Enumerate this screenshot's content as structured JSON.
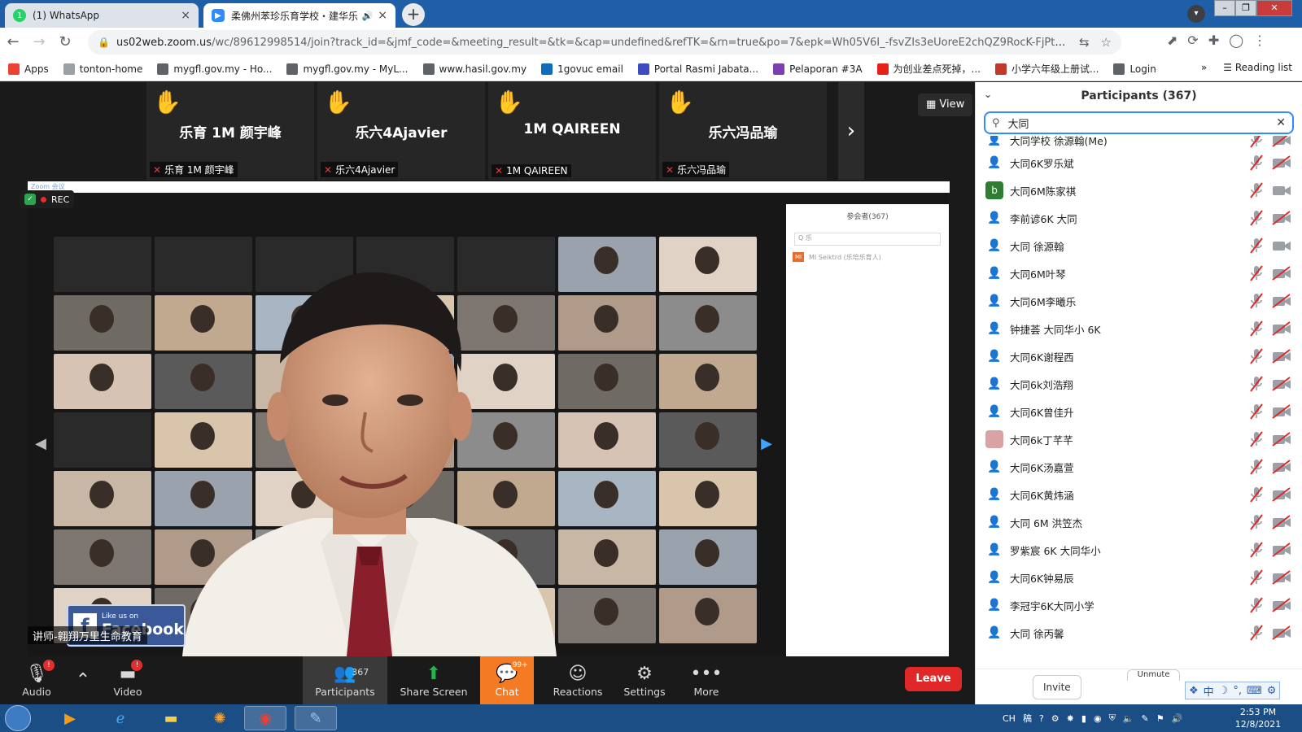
{
  "browser": {
    "tabs": [
      {
        "title": "(1) WhatsApp",
        "favicon": "whatsapp-icon",
        "active": false
      },
      {
        "title": "柔佛州苯珍乐育学校・建华乐",
        "favicon": "zoom-icon",
        "active": true
      }
    ],
    "new_tab_glyph": "+",
    "close_glyph": "×",
    "url_host": "us02web.zoom.us",
    "url_path": "/wc/89612998514/join?track_id=&jmf_code=&meeting_result=&tk=&cap=undefined&refTK=&rn=true&po=7&epk=Wh05V6I_-fsvZIs3eUoreE2chQZ9RocK-FjPtyRHkd3tfElywiU...",
    "bookmarks": [
      {
        "label": "Apps",
        "icon": "apps-grid-icon",
        "color": "#ea4335"
      },
      {
        "label": "tonton-home",
        "icon": "tonton-icon",
        "color": "#9aa0a6"
      },
      {
        "label": "mygfl.gov.my - Ho...",
        "icon": "globe-icon",
        "color": "#5f6368"
      },
      {
        "label": "mygfl.gov.my - MyL...",
        "icon": "globe-icon",
        "color": "#5f6368"
      },
      {
        "label": "www.hasil.gov.my",
        "icon": "globe-icon",
        "color": "#5f6368"
      },
      {
        "label": "1govuc email",
        "icon": "outlook-icon",
        "color": "#0f6cbd"
      },
      {
        "label": "Portal Rasmi Jabata...",
        "icon": "portal-icon",
        "color": "#3b4cc0"
      },
      {
        "label": "Pelaporan #3A",
        "icon": "forms-icon",
        "color": "#7b3fb0"
      },
      {
        "label": "为创业差点死掉，...",
        "icon": "youtube-icon",
        "color": "#e62117"
      },
      {
        "label": "小学六年级上册试...",
        "icon": "ke-icon",
        "color": "#c0392b"
      },
      {
        "label": "Login",
        "icon": "globe-icon",
        "color": "#5f6368"
      }
    ],
    "bookmarks_overflow": "»",
    "reading_list": "Reading list"
  },
  "zoom": {
    "view_label": "View",
    "strip_tiles": [
      {
        "name": "乐育 1M 颜宇峰",
        "label": "乐育 1M 颜宇峰"
      },
      {
        "name": "乐六4Ajavier",
        "label": "乐六4Ajavier"
      },
      {
        "name": "1M QAIREEN",
        "label": "1M QAIREEN"
      },
      {
        "name": "乐六冯品瑜",
        "label": "乐六冯品瑜"
      }
    ],
    "strip_next": "›",
    "rec_label": "REC",
    "speaker_name": "讲师-翱翔万里生命教育",
    "facebook": {
      "like": "Like us on",
      "name": "Facebook"
    },
    "controls": {
      "audio": "Audio",
      "video": "Video",
      "participants": "Participants",
      "participants_count": "367",
      "share": "Share Screen",
      "chat": "Chat",
      "chat_badge": "99+",
      "reactions": "Reactions",
      "settings": "Settings",
      "more": "More",
      "leave": "Leave"
    }
  },
  "participants": {
    "title": "Participants (367)",
    "search_value": "大同",
    "list": [
      {
        "name": "大同学校 徐源翰(Me)",
        "avatar": "default",
        "cam_on": false
      },
      {
        "name": "大同6K罗乐斌",
        "avatar": "default",
        "cam_on": false
      },
      {
        "name": "大同6M陈家祺",
        "avatar": "b",
        "avatar_color": "#2e7d32",
        "cam_on": true
      },
      {
        "name": "李前谚6K 大同",
        "avatar": "default",
        "cam_on": false
      },
      {
        "name": "大同 徐源翰",
        "avatar": "default",
        "cam_on": true
      },
      {
        "name": "大同6M叶琴",
        "avatar": "default",
        "cam_on": false
      },
      {
        "name": "大同6M李曦乐",
        "avatar": "default",
        "cam_on": false
      },
      {
        "name": "钟捷荟 大同华小 6K",
        "avatar": "default",
        "cam_on": false
      },
      {
        "name": "大同6K谢程西",
        "avatar": "default",
        "cam_on": false
      },
      {
        "name": "大同6k刘浩翔",
        "avatar": "default",
        "cam_on": false
      },
      {
        "name": "大同6K曾佳升",
        "avatar": "default",
        "cam_on": false
      },
      {
        "name": "大同6k丁芊芊",
        "avatar": "photo",
        "avatar_color": "#d9a3a3",
        "cam_on": false
      },
      {
        "name": "大同6K汤嘉萱",
        "avatar": "default",
        "cam_on": false
      },
      {
        "name": "大同6K黄炜涵",
        "avatar": "default",
        "cam_on": false
      },
      {
        "name": "大同 6M 洪笠杰",
        "avatar": "default",
        "cam_on": false
      },
      {
        "name": "罗紫宸 6K 大同华小",
        "avatar": "default",
        "cam_on": false
      },
      {
        "name": "大同6K钟易辰",
        "avatar": "default",
        "cam_on": false
      },
      {
        "name": "李冠宇6K大同小学",
        "avatar": "default",
        "cam_on": false
      },
      {
        "name": "大同 徐丙馨",
        "avatar": "default",
        "cam_on": false
      }
    ],
    "invite": "Invite",
    "unmute_all": "Unmute"
  },
  "taskbar": {
    "lang": "CH",
    "time": "2:53 PM",
    "date": "12/8/2021"
  },
  "colors": {
    "zoom_blue": "#2d8cff",
    "leave_red": "#e02828",
    "chat_orange": "#f57a24",
    "hand_yellow": "#f6c21c"
  }
}
